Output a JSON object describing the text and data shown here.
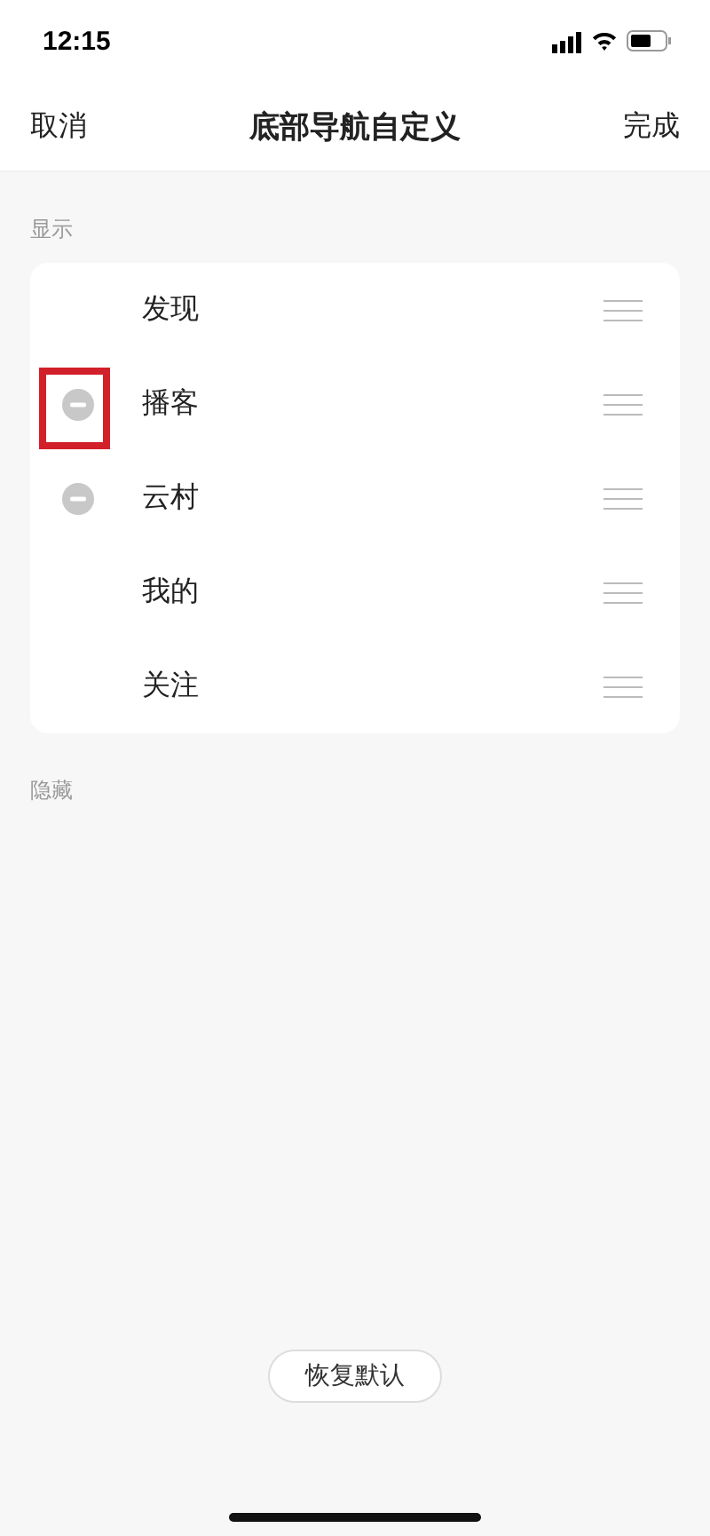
{
  "status_bar": {
    "time": "12:15"
  },
  "nav": {
    "cancel": "取消",
    "title": "底部导航自定义",
    "done": "完成"
  },
  "shown": {
    "label": "显示",
    "items": [
      {
        "label": "发现",
        "removable": false,
        "highlighted": false
      },
      {
        "label": "播客",
        "removable": true,
        "highlighted": true
      },
      {
        "label": "云村",
        "removable": true,
        "highlighted": false
      },
      {
        "label": "我的",
        "removable": false,
        "highlighted": false
      },
      {
        "label": "关注",
        "removable": false,
        "highlighted": false
      }
    ]
  },
  "hidden": {
    "label": "隐藏"
  },
  "reset_button": "恢复默认"
}
